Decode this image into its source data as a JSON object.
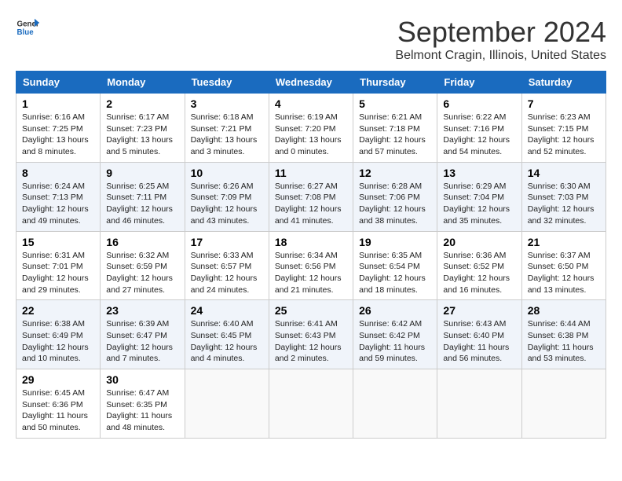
{
  "header": {
    "logo_line1": "General",
    "logo_line2": "Blue",
    "month": "September 2024",
    "location": "Belmont Cragin, Illinois, United States"
  },
  "days_of_week": [
    "Sunday",
    "Monday",
    "Tuesday",
    "Wednesday",
    "Thursday",
    "Friday",
    "Saturday"
  ],
  "weeks": [
    [
      {
        "day": 1,
        "sunrise": "6:16 AM",
        "sunset": "7:25 PM",
        "daylight": "13 hours and 8 minutes."
      },
      {
        "day": 2,
        "sunrise": "6:17 AM",
        "sunset": "7:23 PM",
        "daylight": "13 hours and 5 minutes."
      },
      {
        "day": 3,
        "sunrise": "6:18 AM",
        "sunset": "7:21 PM",
        "daylight": "13 hours and 3 minutes."
      },
      {
        "day": 4,
        "sunrise": "6:19 AM",
        "sunset": "7:20 PM",
        "daylight": "13 hours and 0 minutes."
      },
      {
        "day": 5,
        "sunrise": "6:21 AM",
        "sunset": "7:18 PM",
        "daylight": "12 hours and 57 minutes."
      },
      {
        "day": 6,
        "sunrise": "6:22 AM",
        "sunset": "7:16 PM",
        "daylight": "12 hours and 54 minutes."
      },
      {
        "day": 7,
        "sunrise": "6:23 AM",
        "sunset": "7:15 PM",
        "daylight": "12 hours and 52 minutes."
      }
    ],
    [
      {
        "day": 8,
        "sunrise": "6:24 AM",
        "sunset": "7:13 PM",
        "daylight": "12 hours and 49 minutes."
      },
      {
        "day": 9,
        "sunrise": "6:25 AM",
        "sunset": "7:11 PM",
        "daylight": "12 hours and 46 minutes."
      },
      {
        "day": 10,
        "sunrise": "6:26 AM",
        "sunset": "7:09 PM",
        "daylight": "12 hours and 43 minutes."
      },
      {
        "day": 11,
        "sunrise": "6:27 AM",
        "sunset": "7:08 PM",
        "daylight": "12 hours and 41 minutes."
      },
      {
        "day": 12,
        "sunrise": "6:28 AM",
        "sunset": "7:06 PM",
        "daylight": "12 hours and 38 minutes."
      },
      {
        "day": 13,
        "sunrise": "6:29 AM",
        "sunset": "7:04 PM",
        "daylight": "12 hours and 35 minutes."
      },
      {
        "day": 14,
        "sunrise": "6:30 AM",
        "sunset": "7:03 PM",
        "daylight": "12 hours and 32 minutes."
      }
    ],
    [
      {
        "day": 15,
        "sunrise": "6:31 AM",
        "sunset": "7:01 PM",
        "daylight": "12 hours and 29 minutes."
      },
      {
        "day": 16,
        "sunrise": "6:32 AM",
        "sunset": "6:59 PM",
        "daylight": "12 hours and 27 minutes."
      },
      {
        "day": 17,
        "sunrise": "6:33 AM",
        "sunset": "6:57 PM",
        "daylight": "12 hours and 24 minutes."
      },
      {
        "day": 18,
        "sunrise": "6:34 AM",
        "sunset": "6:56 PM",
        "daylight": "12 hours and 21 minutes."
      },
      {
        "day": 19,
        "sunrise": "6:35 AM",
        "sunset": "6:54 PM",
        "daylight": "12 hours and 18 minutes."
      },
      {
        "day": 20,
        "sunrise": "6:36 AM",
        "sunset": "6:52 PM",
        "daylight": "12 hours and 16 minutes."
      },
      {
        "day": 21,
        "sunrise": "6:37 AM",
        "sunset": "6:50 PM",
        "daylight": "12 hours and 13 minutes."
      }
    ],
    [
      {
        "day": 22,
        "sunrise": "6:38 AM",
        "sunset": "6:49 PM",
        "daylight": "12 hours and 10 minutes."
      },
      {
        "day": 23,
        "sunrise": "6:39 AM",
        "sunset": "6:47 PM",
        "daylight": "12 hours and 7 minutes."
      },
      {
        "day": 24,
        "sunrise": "6:40 AM",
        "sunset": "6:45 PM",
        "daylight": "12 hours and 4 minutes."
      },
      {
        "day": 25,
        "sunrise": "6:41 AM",
        "sunset": "6:43 PM",
        "daylight": "12 hours and 2 minutes."
      },
      {
        "day": 26,
        "sunrise": "6:42 AM",
        "sunset": "6:42 PM",
        "daylight": "11 hours and 59 minutes."
      },
      {
        "day": 27,
        "sunrise": "6:43 AM",
        "sunset": "6:40 PM",
        "daylight": "11 hours and 56 minutes."
      },
      {
        "day": 28,
        "sunrise": "6:44 AM",
        "sunset": "6:38 PM",
        "daylight": "11 hours and 53 minutes."
      }
    ],
    [
      {
        "day": 29,
        "sunrise": "6:45 AM",
        "sunset": "6:36 PM",
        "daylight": "11 hours and 50 minutes."
      },
      {
        "day": 30,
        "sunrise": "6:47 AM",
        "sunset": "6:35 PM",
        "daylight": "11 hours and 48 minutes."
      },
      null,
      null,
      null,
      null,
      null
    ]
  ]
}
